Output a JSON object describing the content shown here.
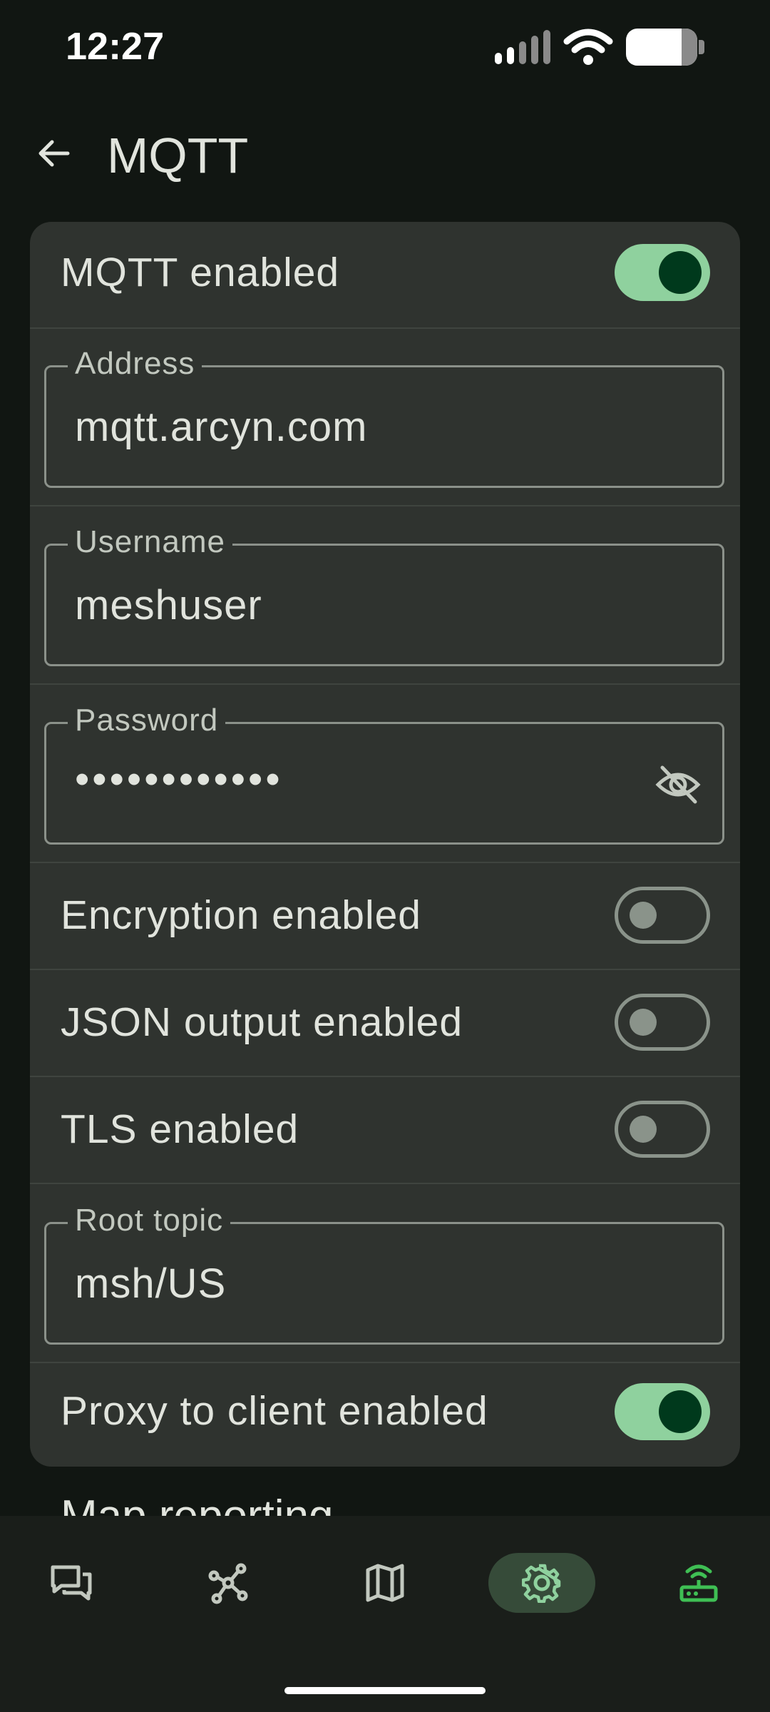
{
  "status_bar": {
    "time": "12:27"
  },
  "header": {
    "title": "MQTT"
  },
  "settings": {
    "mqtt_enabled": {
      "label": "MQTT enabled",
      "on": true
    },
    "address": {
      "label": "Address",
      "value": "mqtt.arcyn.com"
    },
    "username": {
      "label": "Username",
      "value": "meshuser"
    },
    "password": {
      "label": "Password",
      "value": "••••••••••••"
    },
    "encryption_enabled": {
      "label": "Encryption enabled",
      "on": false
    },
    "json_output_enabled": {
      "label": "JSON output enabled",
      "on": false
    },
    "tls_enabled": {
      "label": "TLS enabled",
      "on": false
    },
    "root_topic": {
      "label": "Root topic",
      "value": "msh/US"
    },
    "proxy_to_client_enabled": {
      "label": "Proxy to client enabled",
      "on": true
    }
  },
  "peek_text": "Map reporting",
  "bottom_nav": {
    "items": [
      {
        "icon": "chat-icon",
        "active": false
      },
      {
        "icon": "nodes-icon",
        "active": false
      },
      {
        "icon": "map-icon",
        "active": false
      },
      {
        "icon": "settings-gear-icon",
        "active": true
      },
      {
        "icon": "router-connected-icon",
        "active": false
      }
    ]
  },
  "colors": {
    "background": "#111612",
    "card": "#2f332f",
    "toggle_on_track": "#8fd19e",
    "toggle_on_knob": "#00391c",
    "active_nav_pill": "#364b39",
    "connected_icon": "#3fbf54"
  }
}
